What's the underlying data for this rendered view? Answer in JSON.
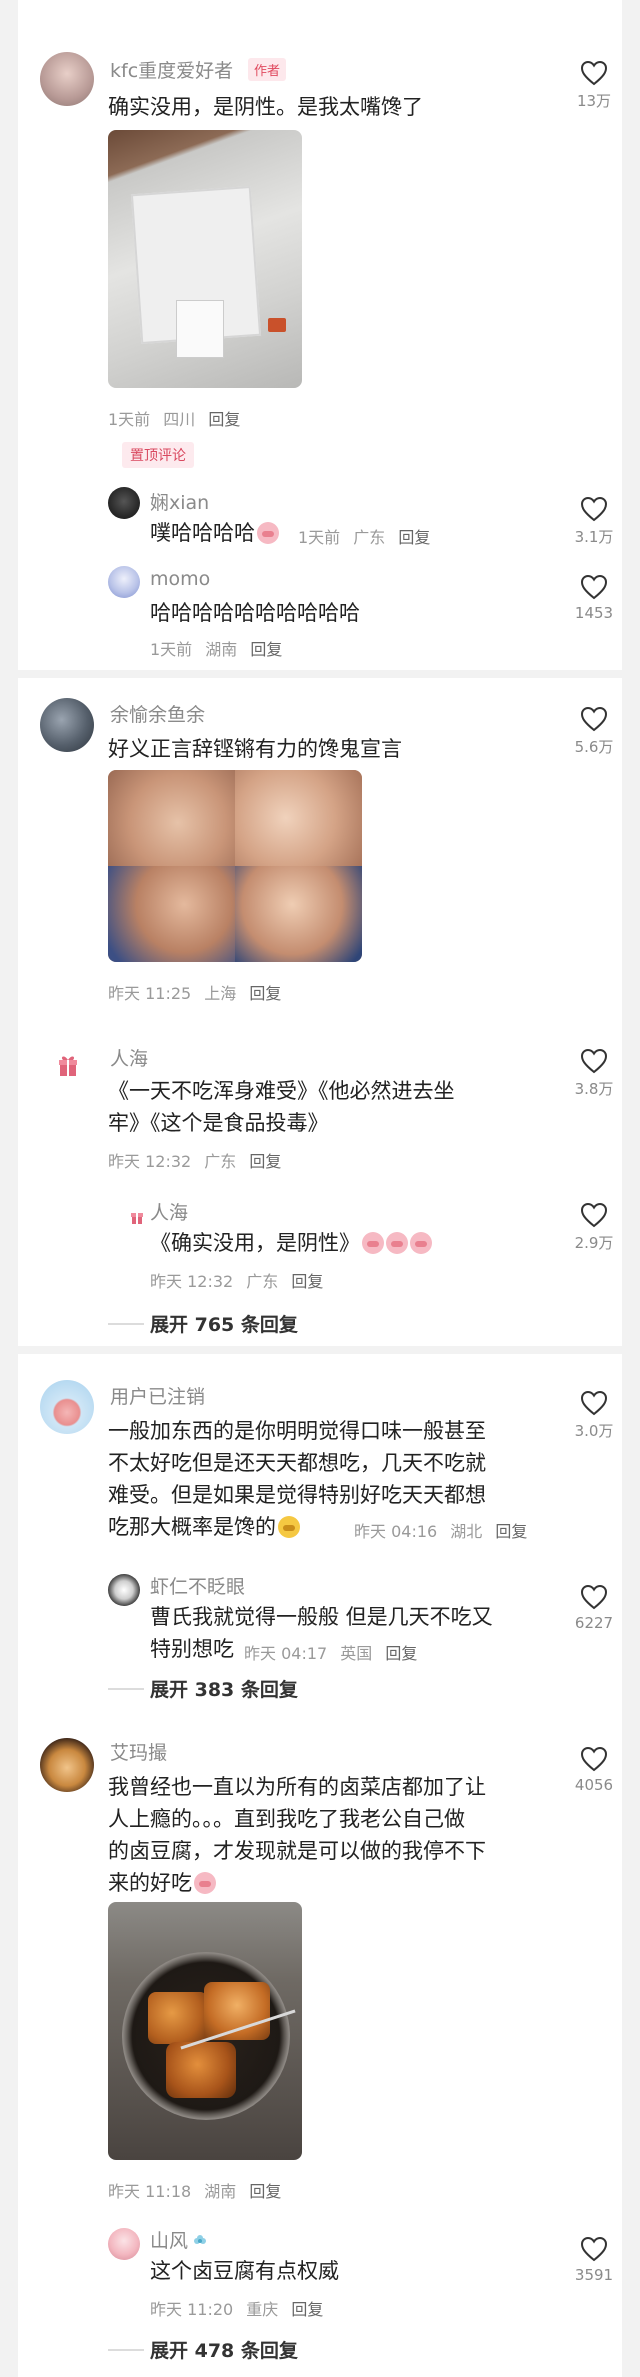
{
  "c1": {
    "name": "kfc重度爱好者",
    "author_badge": "作者",
    "text": "确实没用，是阴性。是我太嘴馋了",
    "meta": {
      "time": "1天前",
      "loc": "四川",
      "reply": "回复"
    },
    "likes": "13万",
    "pinned": "置顶评论",
    "replies": [
      {
        "name": "娴xian",
        "text": "噗哈哈哈哈",
        "time": "1天前",
        "loc": "广东",
        "reply": "回复",
        "likes": "3.1万"
      },
      {
        "name": "momo",
        "text": "哈哈哈哈哈哈哈哈哈哈",
        "time": "1天前",
        "loc": "湖南",
        "reply": "回复",
        "likes": "1453"
      }
    ]
  },
  "c2": {
    "name": "余愉余鱼余",
    "text": "好义正言辞铿锵有力的馋鬼宣言",
    "meta": {
      "time": "昨天 11:25",
      "loc": "上海",
      "reply": "回复"
    },
    "likes": "5.6万",
    "reply1": {
      "name": "人海",
      "line1": "《一天不吃浑身难受》《他必然进去坐",
      "line2": "牢》《这个是食品投毒》",
      "time": "昨天 12:32",
      "loc": "广东",
      "reply": "回复",
      "likes": "3.8万"
    },
    "reply2": {
      "name": "人海",
      "text": "《确实没用，是阴性》",
      "time": "昨天 12:32",
      "loc": "广东",
      "reply": "回复",
      "likes": "2.9万"
    },
    "expand": "展开 765 条回复"
  },
  "c3": {
    "name": "用户已注销",
    "lines": [
      "一般加东西的是你明明觉得口味一般甚至",
      "不太好吃但是还天天都想吃，几天不吃就",
      "难受。但是如果是觉得特别好吃天天都想",
      "吃那大概率是馋的"
    ],
    "meta": {
      "time": "昨天 04:16",
      "loc": "湖北",
      "reply": "回复"
    },
    "likes": "3.0万",
    "reply1": {
      "name": "虾仁不眨眼",
      "line1": "曹氏我就觉得一般般 但是几天不吃又",
      "line2": "特别想吃",
      "time": "昨天 04:17",
      "loc": "英国",
      "reply": "回复",
      "likes": "6227"
    },
    "expand": "展开 383 条回复"
  },
  "c4": {
    "name": "艾玛撮",
    "lines": [
      "我曾经也一直以为所有的卤菜店都加了让",
      "人上瘾的。。。直到我吃了我老公自己做",
      "的卤豆腐，才发现就是可以做的我停不下",
      "来的好吃"
    ],
    "meta": {
      "time": "昨天 11:18",
      "loc": "湖南",
      "reply": "回复"
    },
    "likes": "4056",
    "reply1": {
      "name": "山风",
      "text": "这个卤豆腐有点权威",
      "time": "昨天 11:20",
      "loc": "重庆",
      "reply": "回复",
      "likes": "3591"
    },
    "expand": "展开 478 条回复"
  },
  "colors": {
    "accent_pink": "#e04a5f",
    "muted": "#9a9a9a",
    "bg": "#f2f2f2"
  },
  "icons": [
    "heart-outline-icon",
    "gift-icon",
    "emoji-icon"
  ]
}
